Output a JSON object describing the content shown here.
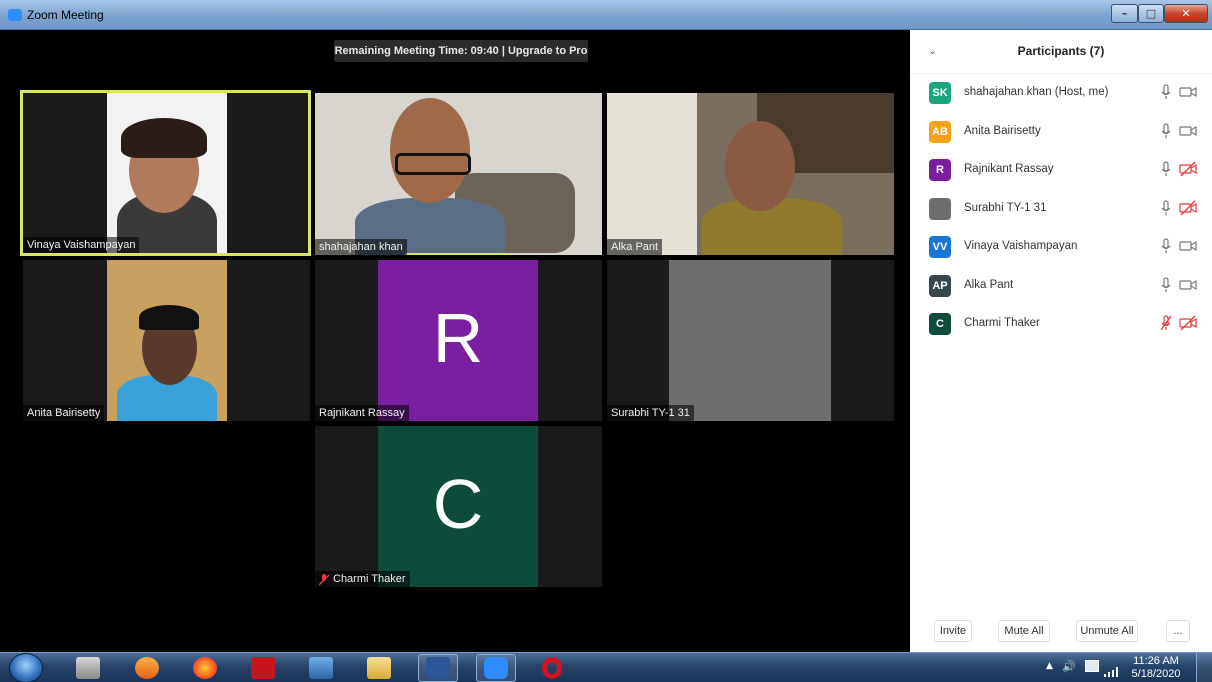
{
  "window": {
    "title": "Zoom Meeting"
  },
  "meeting": {
    "timer_banner": "Remaining Meeting Time: 09:40 | Upgrade to Pro",
    "tiles": [
      {
        "name": "Vinaya Vaishampayan"
      },
      {
        "name": "shahajahan khan"
      },
      {
        "name": "Alka Pant"
      },
      {
        "name": "Anita Bairisetty"
      },
      {
        "name": "Rajnikant Rassay",
        "initial": "R",
        "color": "#7b1fa2"
      },
      {
        "name": "Surabhi TY-1 31"
      },
      {
        "name": "Charmi Thaker",
        "initial": "C",
        "color": "#0d4c3a"
      }
    ]
  },
  "panel": {
    "title": "Participants (7)",
    "participants": [
      {
        "initials": "SK",
        "name": "shahajahan khan (Host, me)",
        "color": "#1aa67f",
        "mic": "on",
        "video": "on"
      },
      {
        "initials": "AB",
        "name": "Anita Bairisetty",
        "color": "#f7a21b",
        "mic": "on",
        "video": "on"
      },
      {
        "initials": "R",
        "name": "Rajnikant Rassay",
        "color": "#7b1fa2",
        "mic": "on",
        "video": "off"
      },
      {
        "initials": "",
        "name": "Surabhi TY-1 31",
        "color": "#6e6e6e",
        "mic": "on",
        "video": "off"
      },
      {
        "initials": "VV",
        "name": "Vinaya Vaishampayan",
        "color": "#1976d2",
        "mic": "on",
        "video": "on"
      },
      {
        "initials": "AP",
        "name": "Alka Pant",
        "color": "#37474f",
        "mic": "on",
        "video": "on"
      },
      {
        "initials": "C",
        "name": "Charmi Thaker",
        "color": "#0d4c3a",
        "mic": "off",
        "video": "off"
      }
    ],
    "buttons": {
      "invite": "Invite",
      "mute_all": "Mute All",
      "unmute_all": "Unmute All",
      "more": "..."
    }
  },
  "taskbar": {
    "time": "11:26 AM",
    "date": "5/18/2020"
  },
  "colors": {
    "active_speaker": "#d8e46a",
    "muted_red": "#e53935",
    "panel_bg": "#ffffff"
  }
}
